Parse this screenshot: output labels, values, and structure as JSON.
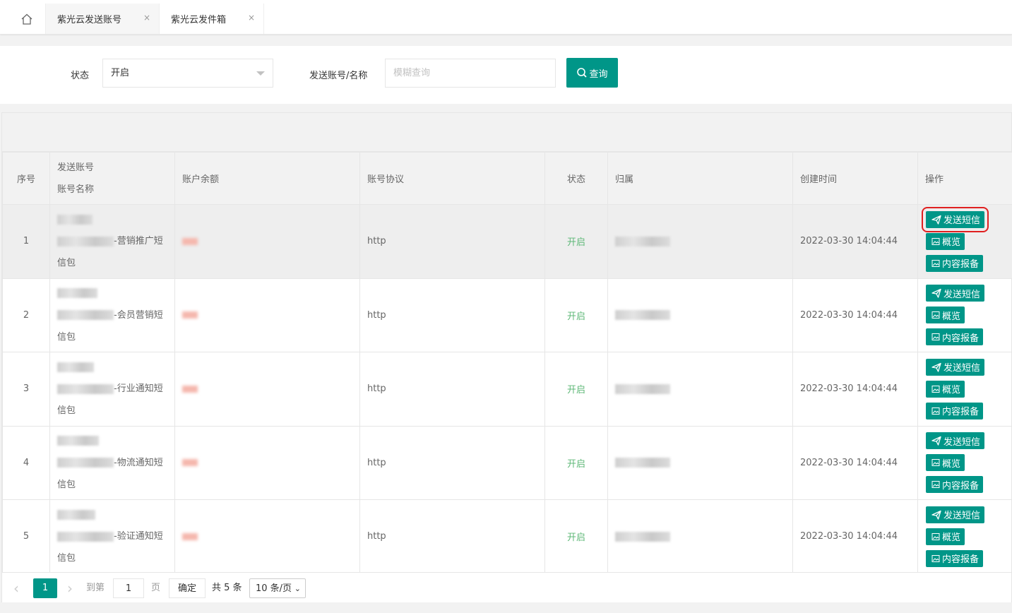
{
  "tabs": [
    {
      "label": "紫光云发送账号",
      "active": true
    },
    {
      "label": "紫光云发件箱",
      "active": false
    }
  ],
  "tab_close_glyph": "×",
  "search": {
    "status_label": "状态",
    "status_value": "开启",
    "account_label": "发送账号/名称",
    "account_placeholder": "模糊查询",
    "query_button": "查询"
  },
  "table": {
    "headers": {
      "index": "序号",
      "account_line1": "发送账号",
      "account_line2": "账号名称",
      "balance": "账户余额",
      "protocol": "账号协议",
      "status": "状态",
      "owner": "归属",
      "created": "创建时间",
      "ops": "操作"
    },
    "rows": [
      {
        "index": "1",
        "name_suffix": "-营销推广短",
        "name_tail": "信包",
        "protocol": "http",
        "status": "开启",
        "created": "2022-03-30 14:04:44",
        "highlight": true
      },
      {
        "index": "2",
        "name_suffix": "-会员营销短",
        "name_tail": "信包",
        "protocol": "http",
        "status": "开启",
        "created": "2022-03-30 14:04:44",
        "highlight": false
      },
      {
        "index": "3",
        "name_suffix": "-行业通知短",
        "name_tail": "信包",
        "protocol": "http",
        "status": "开启",
        "created": "2022-03-30 14:04:44",
        "highlight": false
      },
      {
        "index": "4",
        "name_suffix": "-物流通知短",
        "name_tail": "信包",
        "protocol": "http",
        "status": "开启",
        "created": "2022-03-30 14:04:44",
        "highlight": false
      },
      {
        "index": "5",
        "name_suffix": "-验证通知短",
        "name_tail": "信包",
        "protocol": "http",
        "status": "开启",
        "created": "2022-03-30 14:04:44",
        "highlight": false
      }
    ],
    "op_labels": {
      "send": "发送短信",
      "overview": "概览",
      "report": "内容报备"
    }
  },
  "pager": {
    "prev": "‹",
    "current": "1",
    "next": "›",
    "goto_label": "到第",
    "goto_value": "1",
    "page_unit": "页",
    "confirm": "确定",
    "total": "共 5 条",
    "page_size": "10 条/页"
  },
  "colors": {
    "primary": "#009688",
    "status_on": "#5FB878",
    "highlight_box": "#e02020"
  },
  "icons": {
    "home": "home-icon",
    "search": "search-icon",
    "send": "paper-plane-icon",
    "image": "image-icon"
  }
}
